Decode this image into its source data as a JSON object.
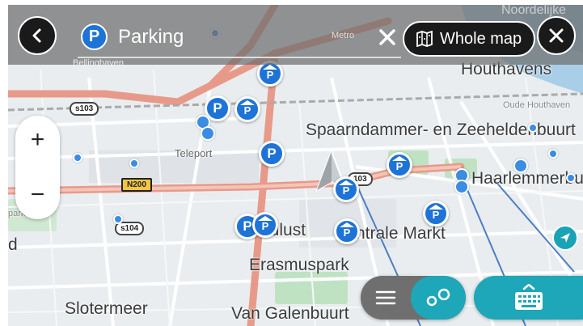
{
  "search": {
    "query": "Parking",
    "badge": "P",
    "clear_icon": "close-icon"
  },
  "header": {
    "whole_map_label": "Whole map",
    "back_icon": "chevron-left-icon",
    "close_icon": "close-icon",
    "whole_map_icon": "map-icon"
  },
  "zoom": {
    "in_label": "+",
    "out_label": "−"
  },
  "map": {
    "labels": {
      "houthavens": "Houthavens",
      "oude_houthaven": "Oude Houthaven",
      "spaarndammer": "Spaarndammer- en Zeeheldenbuurt",
      "teleport": "Teleport",
      "haarlemmerbuurt": "Haarlemmerbuurt",
      "ondlust": "ndlust",
      "centrale_markt": "ntrale Markt",
      "erasmuspark": "Erasmuspark",
      "slotermeer": "Slotermeer",
      "van_galenbuurt": "Van Galenbuurt",
      "noordelijke": "Noordelijke",
      "metro": "Metro",
      "bellinghaven": "Bellinghaven",
      "park": "park",
      "d": "d"
    },
    "shields": {
      "s103": "s103",
      "n200": "N200",
      "s104": "s104",
      "a103": "103"
    },
    "pin_glyph": "P",
    "pin_house_glyph": "P"
  },
  "controls": {
    "list_icon": "list-icon",
    "map_view_icon": "map-pins-icon",
    "keyboard_icon": "keyboard-icon",
    "compass_icon": "compass-icon"
  },
  "colors": {
    "accent": "#1ea7b8",
    "pin": "#1e73d6",
    "road_main": "#e89a8a",
    "road_secondary": "#ffffff",
    "park": "#bfe3c2",
    "water": "#a9cfe8"
  }
}
